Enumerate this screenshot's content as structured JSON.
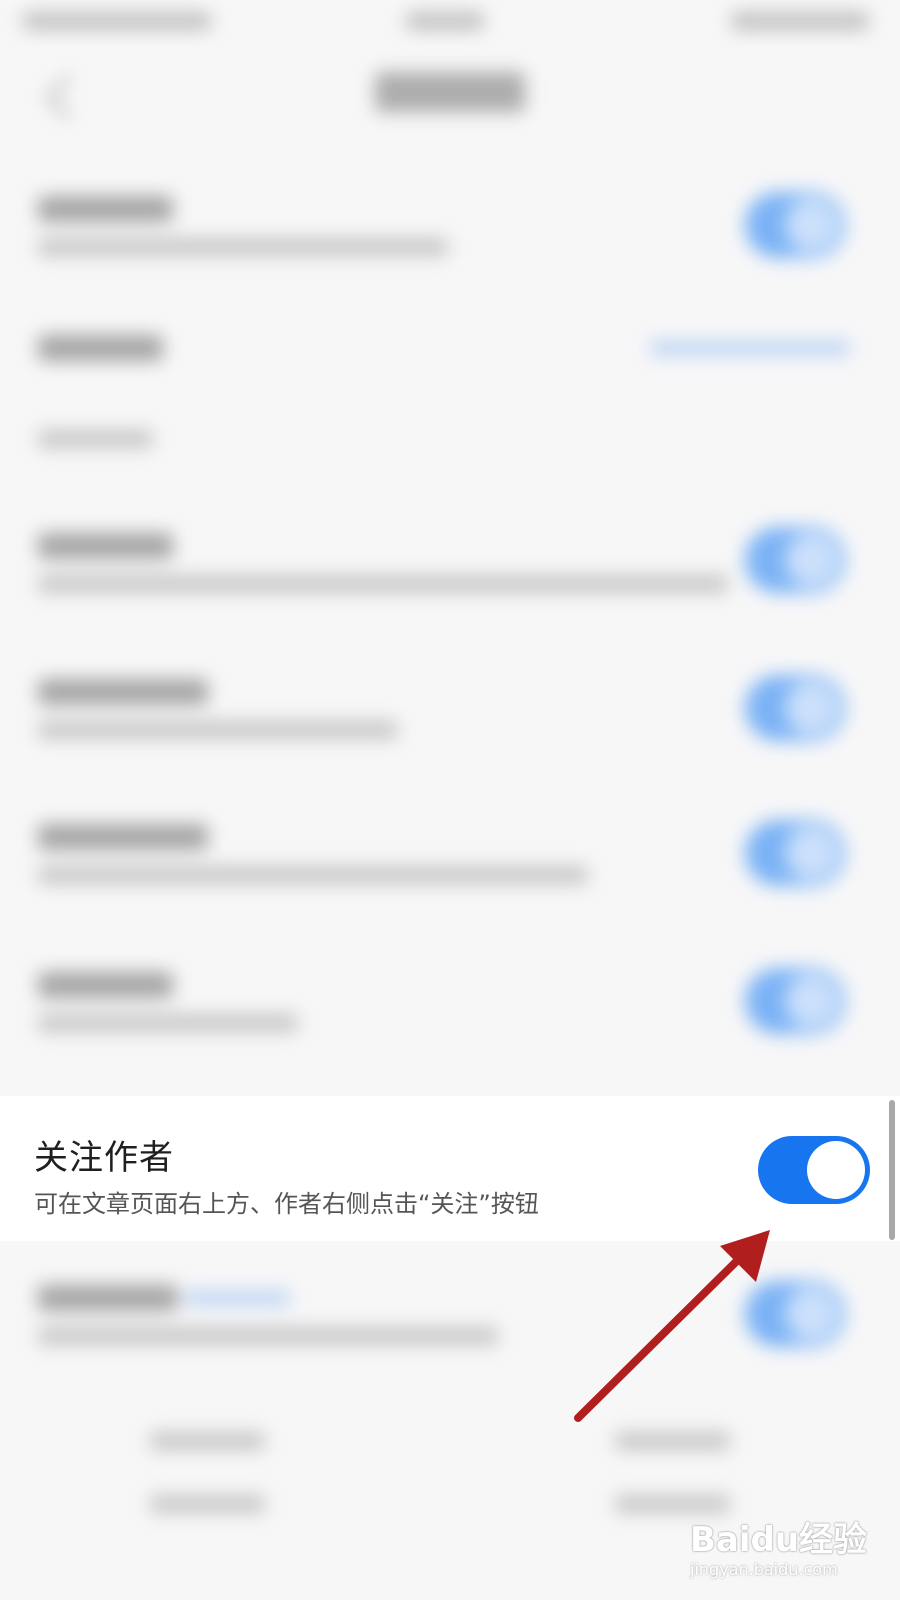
{
  "setting": {
    "title": "关注作者",
    "description": "可在文章页面右上方、作者右侧点击“关注”按钮",
    "toggle_on": true
  },
  "colors": {
    "accent": "#1875f0",
    "arrow": "#b01e1e",
    "background": "#f7f7f8"
  },
  "watermark": {
    "logo_text": "Baidu经验",
    "url": "jingyan.baidu.com"
  }
}
